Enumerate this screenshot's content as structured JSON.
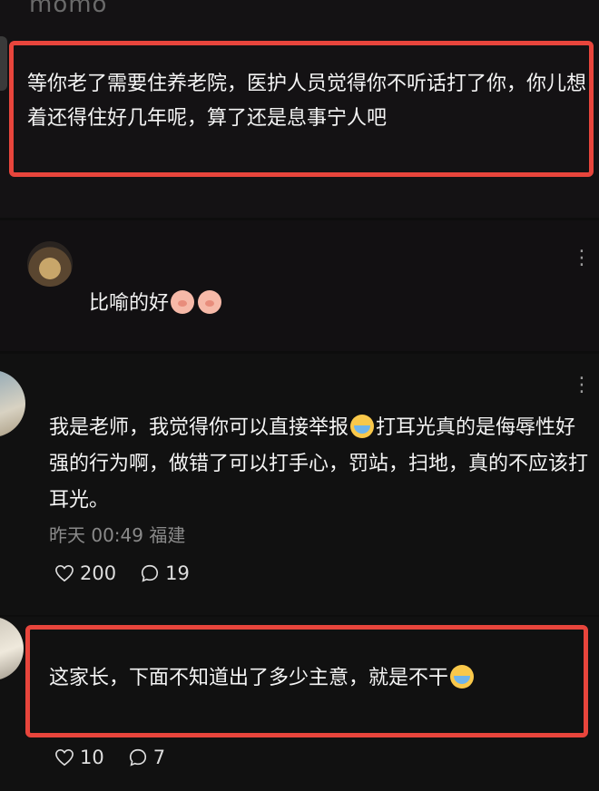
{
  "comments": [
    {
      "username": "momo",
      "text": "等你老了需要住养老院，医护人员觉得你不听话打了你，你儿想着还得住好几年呢，算了还是息事宁人吧"
    },
    {
      "text": "比喻的好",
      "emojis": [
        "pig-emoji",
        "pig-emoji"
      ]
    },
    {
      "text_part1": "我是老师，我觉得你可以直接举报",
      "text_part2": "打耳光真的是侮辱性好强的行为啊，做错了可以打手心，罚站，扫地，真的不应该打耳光。",
      "emoji": "crying-emoji",
      "time": "昨天 00:49",
      "location": "福建",
      "likes": "200",
      "replies": "19"
    },
    {
      "text": "这家长，下面不知道出了多少主意，就是不干",
      "emoji": "crying-emoji",
      "likes": "10",
      "replies": "7"
    }
  ],
  "colors": {
    "highlight_box": "#e8453c",
    "background": "#111111"
  },
  "icons": {
    "more": "⋮",
    "like": "heart-outline-icon",
    "reply": "speech-bubble-icon"
  }
}
